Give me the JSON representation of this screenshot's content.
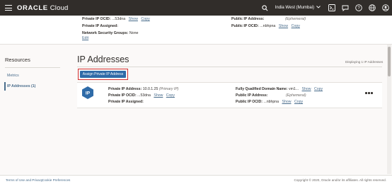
{
  "header": {
    "brand": "ORACLE",
    "product": "Cloud",
    "region": "India West (Mumbai)"
  },
  "upper": {
    "private_ocid_label": "Private IP OCID:",
    "private_ocid_value": "...53dna",
    "private_assigned_label": "Private IP Assigned:",
    "nsg_label": "Network Security Groups:",
    "nsg_value": "None",
    "edit": "Edit",
    "public_ip_label": "Public IP Address:",
    "public_ip_value": "(Ephemeral)",
    "public_ocid_label": "Public IP OCID:",
    "public_ocid_value": "...nbhpna",
    "show": "Show",
    "copy": "Copy"
  },
  "resources": {
    "title": "Resources",
    "items": [
      {
        "label": "Metrics"
      },
      {
        "label": "IP Addresses (1)"
      }
    ]
  },
  "section": {
    "title": "IP Addresses",
    "displaying": "Displaying 1 IP Addresses",
    "assign_button": "Assign Private IP Address"
  },
  "row": {
    "icon_text": "IP",
    "private_ip_label": "Private IP Address:",
    "private_ip_value": "10.0.1.25",
    "primary": "(Primary IP)",
    "private_ocid_label": "Private IP OCID:",
    "private_ocid_value": "...53dna",
    "private_assigned_label": "Private IP Assigned:",
    "fqdn_label": "Fully Qualified Domain Name:",
    "fqdn_value": "vm1...",
    "public_ip_label": "Public IP Address:",
    "public_ip_value": "(Ephemeral)",
    "public_ocid_label": "Public IP OCID:",
    "public_ocid_value": "...nbhpna",
    "show": "Show",
    "copy": "Copy"
  },
  "footer": {
    "terms": "Terms of Use and Privacy",
    "cookies": "Cookie Preferences",
    "copyright": "Copyright © 2020, Oracle and/or its affiliates. All rights reserved."
  },
  "colors": {
    "header_bg": "#312d2a",
    "link": "#4a6d8c",
    "button": "#2f6ba8",
    "highlight": "#d32f2f",
    "ip_icon": "#2f6ba8"
  }
}
